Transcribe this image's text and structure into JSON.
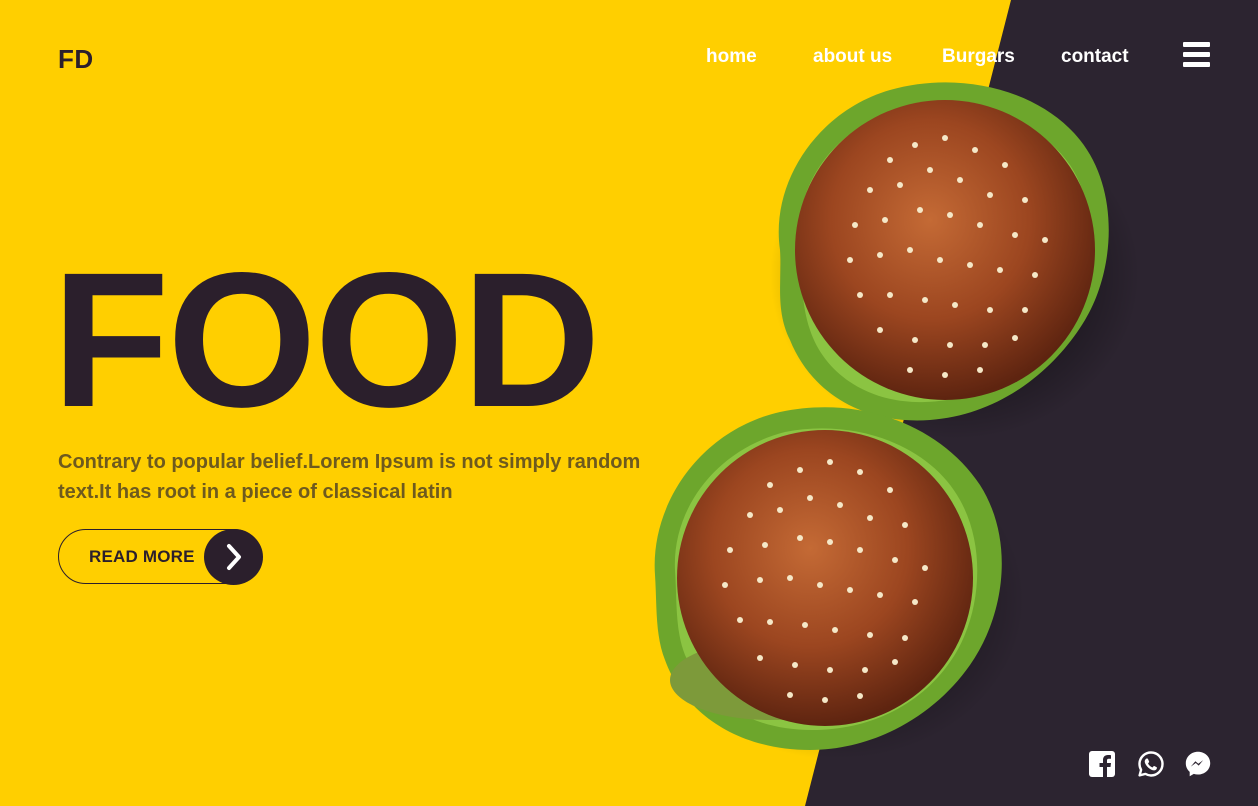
{
  "brand": {
    "logo": "FD"
  },
  "nav": {
    "items": [
      {
        "label": "home"
      },
      {
        "label": "about us"
      },
      {
        "label": "Burgars"
      },
      {
        "label": "contact"
      }
    ],
    "menu_icon": "hamburger-menu-icon"
  },
  "hero": {
    "title": "FOOD",
    "description": "Contrary to popular belief.Lorem Ipsum is not simply random text.It has root in a piece of classical latin",
    "cta_label": "READ MORE",
    "cta_icon": "chevron-right-icon"
  },
  "images": [
    {
      "name": "burger-top",
      "alt": "sesame burger"
    },
    {
      "name": "burger-bottom",
      "alt": "sesame burger"
    }
  ],
  "social": [
    {
      "icon": "facebook-icon"
    },
    {
      "icon": "whatsapp-icon"
    },
    {
      "icon": "messenger-icon"
    }
  ],
  "colors": {
    "accent_yellow": "#FFCF00",
    "dark": "#2C2430",
    "text_dark": "#2B1F2C",
    "text_muted": "#6E5A1E",
    "white": "#FFFFFF"
  }
}
